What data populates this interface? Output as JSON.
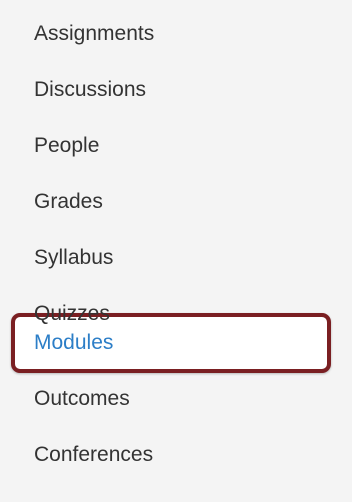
{
  "course_navigation": {
    "items": [
      {
        "label": "Assignments"
      },
      {
        "label": "Discussions"
      },
      {
        "label": "People"
      },
      {
        "label": "Grades"
      },
      {
        "label": "Syllabus"
      },
      {
        "label": "Quizzes"
      },
      {
        "label": "Modules",
        "active": true
      },
      {
        "label": "Outcomes"
      },
      {
        "label": "Conferences"
      }
    ],
    "active_color": "#2c7ec7",
    "text_color": "#333333",
    "highlight_border_color": "#7a1f22",
    "background_color": "#f4f4f4"
  }
}
